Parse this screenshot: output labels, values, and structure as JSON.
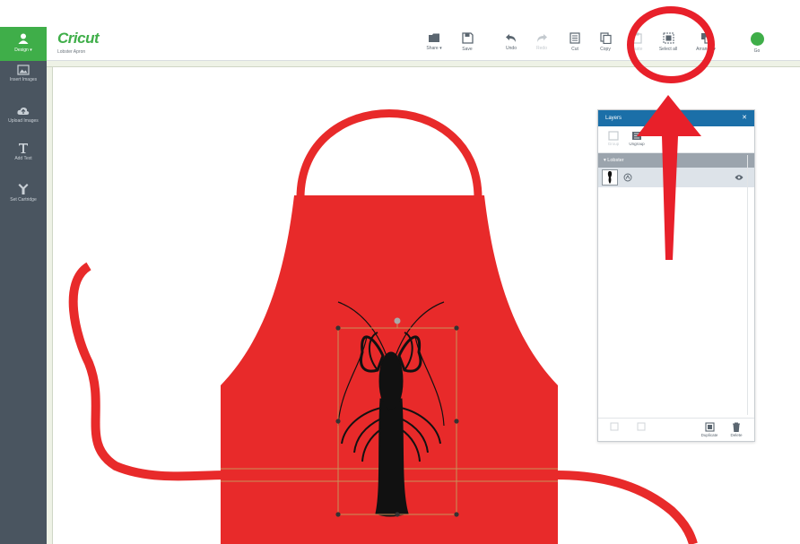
{
  "colors": {
    "sidebar": "#4a5560",
    "brand_green": "#3fae49",
    "apron_red": "#e82a2a",
    "annotation_red": "#e8202a",
    "layers_header": "#1b6fa8",
    "selection": "#c9925a"
  },
  "sidebar": {
    "user_label": "Design ▾",
    "items": [
      {
        "label": "Insert Images",
        "icon": "image-icon"
      },
      {
        "label": "Upload Images",
        "icon": "upload-icon"
      },
      {
        "label": "Add Text",
        "icon": "text-icon"
      },
      {
        "label": "Set Cartridge",
        "icon": "cartridge-icon"
      }
    ]
  },
  "header": {
    "logo": "Cricut",
    "project": "Lobster Apron"
  },
  "toolbar": {
    "items": [
      {
        "label": "Share ▾",
        "icon": "folder-icon"
      },
      {
        "label": "Save",
        "icon": "save-icon"
      },
      {
        "label": "Undo",
        "icon": "undo-icon"
      },
      {
        "label": "Redo",
        "icon": "redo-icon"
      },
      {
        "label": "Cut",
        "icon": "cut-icon"
      },
      {
        "label": "Copy",
        "icon": "copy-icon"
      },
      {
        "label": "Paste",
        "icon": "paste-icon"
      },
      {
        "label": "Select all",
        "icon": "select-all-icon"
      },
      {
        "label": "Arrange ▾",
        "icon": "arrange-icon"
      }
    ],
    "go_label": "Go"
  },
  "layers_panel": {
    "title": "Layers",
    "close": "✕",
    "tools": [
      {
        "label": "Group",
        "icon": "group-icon"
      },
      {
        "label": "Ungroup",
        "icon": "ungroup-icon"
      }
    ],
    "group_name": "▾ Lobster",
    "footer": [
      {
        "label": "Duplicate",
        "icon": "duplicate-icon"
      },
      {
        "label": "Delete",
        "icon": "delete-icon"
      }
    ]
  }
}
